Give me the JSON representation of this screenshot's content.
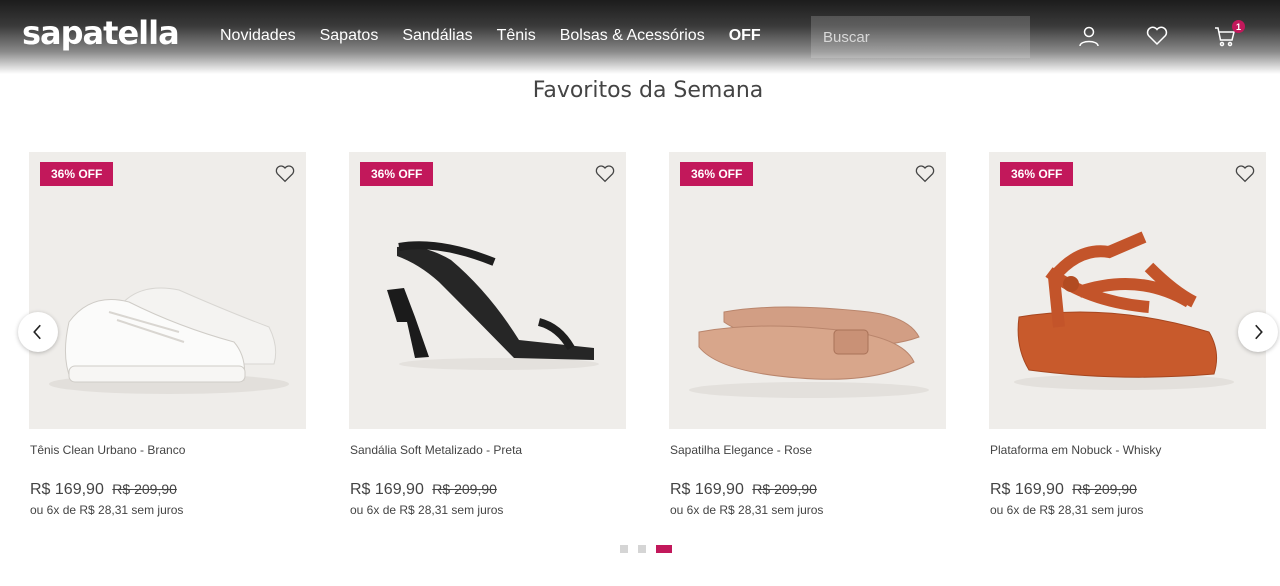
{
  "brand": {
    "logo": "sapatella",
    "accent_color": "#c2185b"
  },
  "nav": {
    "items": [
      "Novidades",
      "Sapatos",
      "Sandálias",
      "Tênis",
      "Bolsas & Acessórios",
      "OFF"
    ]
  },
  "search": {
    "placeholder": "Buscar",
    "icon": "search-icon"
  },
  "header_icons": {
    "account": "user-icon",
    "wishlist": "heart-icon",
    "cart": "cart-icon",
    "cart_count": "1"
  },
  "section": {
    "title": "Favoritos da Semana"
  },
  "products": [
    {
      "tag": "36% OFF",
      "name": "Tênis Clean Urbano - Branco",
      "price": "R$ 169,90",
      "old_price": "R$ 209,90",
      "installments": "ou 6x de R$ 28,31 sem juros"
    },
    {
      "tag": "36% OFF",
      "name": "Sandália Soft Metalizado - Preta",
      "price": "R$ 169,90",
      "old_price": "R$ 209,90",
      "installments": "ou 6x de R$ 28,31 sem juros"
    },
    {
      "tag": "36% OFF",
      "name": "Sapatilha Elegance - Rose",
      "price": "R$ 169,90",
      "old_price": "R$ 209,90",
      "installments": "ou 6x de R$ 28,31 sem juros"
    },
    {
      "tag": "36% OFF",
      "name": "Plataforma em Nobuck - Whisky",
      "price": "R$ 169,90",
      "old_price": "R$ 209,90",
      "installments": "ou 6x de R$ 28,31 sem juros"
    }
  ],
  "carousel": {
    "prev_icon": "chevron-left-icon",
    "next_icon": "chevron-right-icon",
    "page_count": 3,
    "active_page": 3
  }
}
